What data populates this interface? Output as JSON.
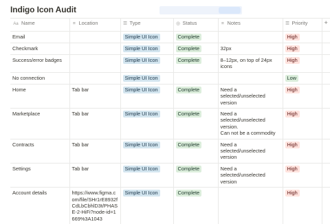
{
  "page": {
    "title": "Indigo Icon Audit"
  },
  "columns": [
    {
      "label": "Name",
      "icon": "text-icon"
    },
    {
      "label": "Location",
      "icon": "text-lines-icon"
    },
    {
      "label": "Type",
      "icon": "list-icon"
    },
    {
      "label": "Status",
      "icon": "status-icon"
    },
    {
      "label": "Notes",
      "icon": "text-lines-icon"
    },
    {
      "label": "Priority",
      "icon": "list-icon"
    }
  ],
  "add_column": "+",
  "tag_colors": {
    "type": {
      "bg": "#d3e5ef",
      "fg": "#183347"
    },
    "status": {
      "bg": "#dbeddb",
      "fg": "#1c3829"
    },
    "high": {
      "bg": "#ffe2dd",
      "fg": "#5d1715"
    },
    "low": {
      "bg": "#dbeddb",
      "fg": "#1c3829"
    }
  },
  "rows": [
    {
      "name": "Email",
      "location": "",
      "type": "Simple UI Icon",
      "status": "Complete",
      "notes": "",
      "priority": "High"
    },
    {
      "name": "Checkmark",
      "location": "",
      "type": "Simple UI Icon",
      "status": "Complete",
      "notes": "32px",
      "priority": "High"
    },
    {
      "name": "Success/error badges",
      "location": "",
      "type": "Simple UI Icon",
      "status": "Complete",
      "notes": "8–12px, on top of 24px icons",
      "priority": "High"
    },
    {
      "name": "No connection",
      "location": "",
      "type": "Simple UI Icon",
      "status": "",
      "notes": "",
      "priority": "Low"
    },
    {
      "name": "Home",
      "location": "Tab bar",
      "type": "Simple UI Icon",
      "status": "Complete",
      "notes": "Need a selected/unselected version",
      "priority": "High"
    },
    {
      "name": "Marketplace",
      "location": "Tab bar",
      "type": "Simple UI Icon",
      "status": "Complete",
      "notes": "Need a selected/unselected version.\nCan not be a commodity",
      "priority": "High"
    },
    {
      "name": "Contracts",
      "location": "Tab bar",
      "type": "Simple UI Icon",
      "status": "Complete",
      "notes": "Need a selected/unselected version",
      "priority": "High"
    },
    {
      "name": "Settings",
      "location": "Tab bar",
      "type": "Simple UI Icon",
      "status": "Complete",
      "notes": "Need a selected/unselected version",
      "priority": "High"
    },
    {
      "name": "Account details",
      "location": "https://www.figma.com/file/SHr1rE8932fCdLbCbhlD3t/PHASE-2-HiFi?node-id=1669%3A1043",
      "type": "Simple UI Icon",
      "status": "Complete",
      "notes": "",
      "priority": "High"
    }
  ]
}
